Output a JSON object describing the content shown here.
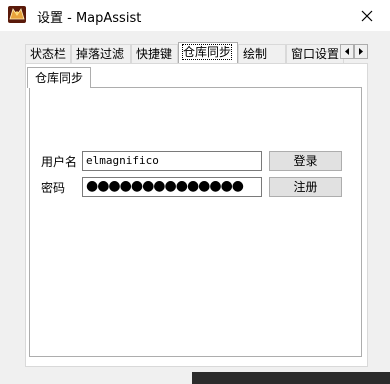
{
  "window": {
    "title": "设置 - MapAssist"
  },
  "tabs": [
    {
      "label": "状态栏"
    },
    {
      "label": "掉落过滤"
    },
    {
      "label": "快捷键"
    },
    {
      "label": "仓库同步"
    },
    {
      "label": "绘制"
    },
    {
      "label": "窗口设置"
    }
  ],
  "selected_tab": "仓库同步",
  "inner_tab": {
    "label": "仓库同步"
  },
  "form": {
    "username_label": "用户名",
    "username_value": "elmagnifico",
    "password_label": "密码",
    "password_mask": "●●●●●●●●●●●●●●",
    "login_button": "登录",
    "register_button": "注册"
  },
  "icons": {
    "app": "mapassist-app-icon",
    "close": "close-icon",
    "tab_prev": "arrow-left-icon",
    "tab_next": "arrow-right-icon"
  }
}
